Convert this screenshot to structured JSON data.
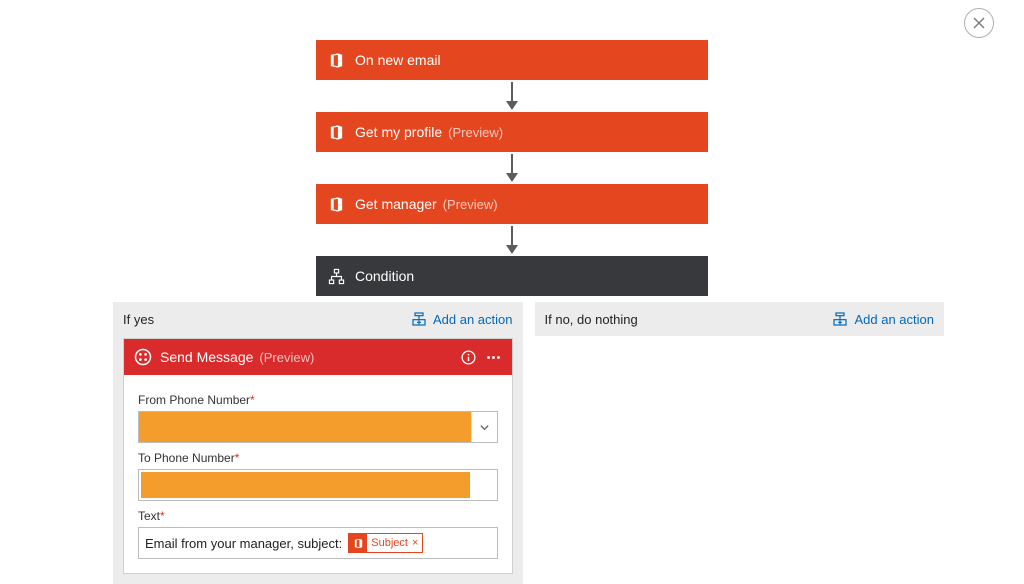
{
  "flow": {
    "cards": [
      {
        "label": "On new email",
        "preview": "",
        "style": "orange",
        "icon": "office"
      },
      {
        "label": "Get my profile",
        "preview": "(Preview)",
        "style": "orange",
        "icon": "office"
      },
      {
        "label": "Get manager",
        "preview": "(Preview)",
        "style": "orange",
        "icon": "office"
      },
      {
        "label": "Condition",
        "preview": "",
        "style": "dark",
        "icon": "condition"
      }
    ]
  },
  "branches": {
    "yes": {
      "title": "If yes",
      "add_action_label": "Add an action"
    },
    "no": {
      "title": "If no, do nothing",
      "add_action_label": "Add an action"
    }
  },
  "sendMessage": {
    "title": "Send Message",
    "preview": "(Preview)",
    "fields": {
      "from_label": "From Phone Number",
      "to_label": "To Phone Number",
      "text_label": "Text",
      "text_value_prefix": "Email from your manager, subject:"
    },
    "token": {
      "label": "Subject",
      "close": "×"
    }
  },
  "required_mark": "*"
}
